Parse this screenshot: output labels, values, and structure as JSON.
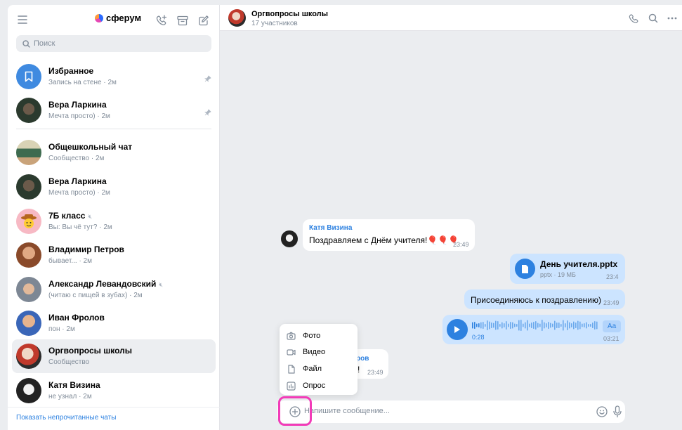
{
  "brand": {
    "name": "сферум"
  },
  "sidebar": {
    "search_placeholder": "Поиск",
    "show_unread": "Показать непрочитанные чаты",
    "chats": [
      {
        "name": "Избранное",
        "sub": "Запись на стене · 2м",
        "pinned": true,
        "avatar": "bookmark-icon"
      },
      {
        "name": "Вера Ларкина",
        "sub": "Мечта просто) · 2м",
        "pinned": true
      },
      {
        "name": "Общешкольный чат",
        "sub": "Сообщество · 2м"
      },
      {
        "name": "Вера Ларкина",
        "sub": "Мечта просто) · 2м"
      },
      {
        "name": "7Б класс",
        "sub": "Вы: Вы чё тут? · 2м",
        "muted": true
      },
      {
        "name": "Владимир Петров",
        "sub": "бывает... · 2м"
      },
      {
        "name": "Александр Левандовский",
        "sub": "(читаю с пищей в зубах) · 2м",
        "muted": true
      },
      {
        "name": "Иван Фролов",
        "sub": "пон · 2м"
      },
      {
        "name": "Оргвопросы школы",
        "sub": "Сообщество",
        "active": true
      },
      {
        "name": "Катя Визина",
        "sub": "не узнал · 2м"
      }
    ]
  },
  "chat": {
    "title": "Оргвопросы школы",
    "subtitle": "17 участников",
    "messages": [
      {
        "author": "Катя Визина",
        "text": "Поздравляем с Днём учителя!🎈🎈🎈",
        "time": "23:49",
        "direction": "in"
      },
      {
        "file_name": "День учителя.pptx",
        "file_meta": "pptx · 19 МБ",
        "time": "23:4",
        "direction": "out"
      },
      {
        "text": "Присоединяюсь к поздравлению)",
        "time": "23:49",
        "direction": "out"
      },
      {
        "voice_duration": "0:28",
        "time": "03:21",
        "transcribe_label": "Аа",
        "direction": "out"
      },
      {
        "author_partial": "ров",
        "text_partial": "!",
        "time": "23:49",
        "direction": "in"
      }
    ],
    "attach_menu": [
      {
        "label": "Фото",
        "icon": "camera-icon"
      },
      {
        "label": "Видео",
        "icon": "video-icon"
      },
      {
        "label": "Файл",
        "icon": "file-icon"
      },
      {
        "label": "Опрос",
        "icon": "poll-icon"
      }
    ],
    "composer_placeholder": "Напишите сообщение..."
  },
  "colors": {
    "accent": "#2d81e0",
    "outgoing": "#cce4ff",
    "highlight": "#f23bb8"
  }
}
